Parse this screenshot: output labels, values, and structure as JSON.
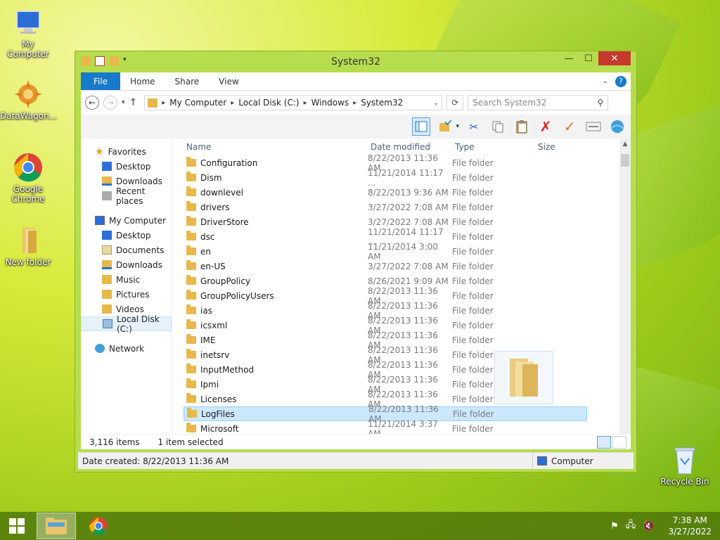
{
  "desktop": {
    "icons": [
      {
        "label": "My Computer"
      },
      {
        "label": "DataWagon..."
      },
      {
        "label": "Google Chrome"
      },
      {
        "label": "New folder"
      },
      {
        "label": "Recycle Bin"
      }
    ]
  },
  "window": {
    "title": "System32",
    "tabs": [
      "File",
      "Home",
      "Share",
      "View"
    ],
    "address": {
      "path": [
        "My Computer",
        "Local Disk (C:)",
        "Windows",
        "System32"
      ]
    },
    "search_placeholder": "Search System32",
    "nav": {
      "favorites": {
        "label": "Favorites",
        "items": [
          "Desktop",
          "Downloads",
          "Recent places"
        ]
      },
      "computer": {
        "label": "My Computer",
        "items": [
          "Desktop",
          "Documents",
          "Downloads",
          "Music",
          "Pictures",
          "Videos",
          "Local Disk (C:)"
        ]
      },
      "network": {
        "label": "Network"
      }
    },
    "columns": {
      "name": "Name",
      "date": "Date modified",
      "type": "Type",
      "size": "Size"
    },
    "files": [
      {
        "name": "Configuration",
        "date": "8/22/2013 11:36 AM",
        "type": "File folder"
      },
      {
        "name": "Dism",
        "date": "11/21/2014 11:17 ...",
        "type": "File folder"
      },
      {
        "name": "downlevel",
        "date": "8/22/2013 9:36 AM",
        "type": "File folder"
      },
      {
        "name": "drivers",
        "date": "3/27/2022 7:08 AM",
        "type": "File folder"
      },
      {
        "name": "DriverStore",
        "date": "3/27/2022 7:08 AM",
        "type": "File folder"
      },
      {
        "name": "dsc",
        "date": "11/21/2014 11:17 ...",
        "type": "File folder"
      },
      {
        "name": "en",
        "date": "11/21/2014 3:00 AM",
        "type": "File folder"
      },
      {
        "name": "en-US",
        "date": "3/27/2022 7:08 AM",
        "type": "File folder"
      },
      {
        "name": "GroupPolicy",
        "date": "8/26/2021 9:09 AM",
        "type": "File folder"
      },
      {
        "name": "GroupPolicyUsers",
        "date": "8/22/2013 11:36 AM",
        "type": "File folder"
      },
      {
        "name": "ias",
        "date": "8/22/2013 11:36 AM",
        "type": "File folder"
      },
      {
        "name": "icsxml",
        "date": "8/22/2013 11:36 AM",
        "type": "File folder"
      },
      {
        "name": "IME",
        "date": "8/22/2013 11:36 AM",
        "type": "File folder"
      },
      {
        "name": "inetsrv",
        "date": "8/22/2013 11:36 AM",
        "type": "File folder"
      },
      {
        "name": "InputMethod",
        "date": "8/22/2013 11:36 AM",
        "type": "File folder"
      },
      {
        "name": "Ipmi",
        "date": "8/22/2013 11:36 AM",
        "type": "File folder"
      },
      {
        "name": "Licenses",
        "date": "8/22/2013 11:36 AM",
        "type": "File folder"
      },
      {
        "name": "LogFiles",
        "date": "8/22/2013 11:36 AM",
        "type": "File folder",
        "selected": true
      },
      {
        "name": "Microsoft",
        "date": "11/21/2014 3:37 AM",
        "type": "File folder"
      }
    ],
    "status": {
      "count": "3,116 items",
      "selected": "1 item selected"
    },
    "details": {
      "date_created": "Date created: 8/22/2013 11:36 AM",
      "location": "Computer"
    }
  },
  "taskbar": {
    "time": "7:38 AM",
    "date": "3/27/2022"
  },
  "colors": {
    "accent": "#1979ca",
    "selection": "#cce8ff",
    "close": "#c7382d"
  }
}
